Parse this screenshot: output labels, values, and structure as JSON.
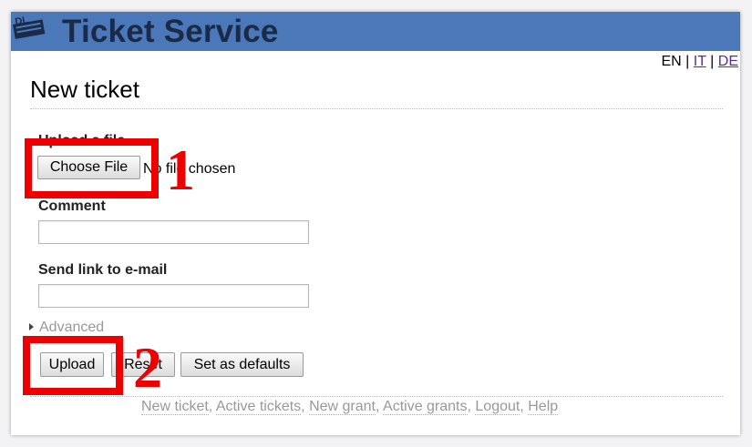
{
  "header": {
    "title": "Ticket Service",
    "logo_icon": "ticket-logo-icon",
    "bg_color": "#4a78b8"
  },
  "languages": {
    "current": "EN",
    "sep1": "|",
    "it": "IT",
    "sep2": "|",
    "de": "DE"
  },
  "page": {
    "heading": "New ticket"
  },
  "upload": {
    "label": "Upload a file",
    "choose_button": "Choose File",
    "status": "No file chosen"
  },
  "comment": {
    "label": "Comment",
    "value": ""
  },
  "email": {
    "label": "Send link to e-mail",
    "value": ""
  },
  "advanced": {
    "label": "Advanced",
    "expanded": false
  },
  "actions": {
    "upload": "Upload",
    "reset": "Reset",
    "set_defaults": "Set as defaults"
  },
  "footer": {
    "links": [
      "New ticket",
      "Active tickets",
      "New grant",
      "Active grants",
      "Logout",
      "Help"
    ],
    "sep": ","
  },
  "annotations": {
    "n1": "1",
    "n2": "2",
    "color": "#ee0000"
  }
}
